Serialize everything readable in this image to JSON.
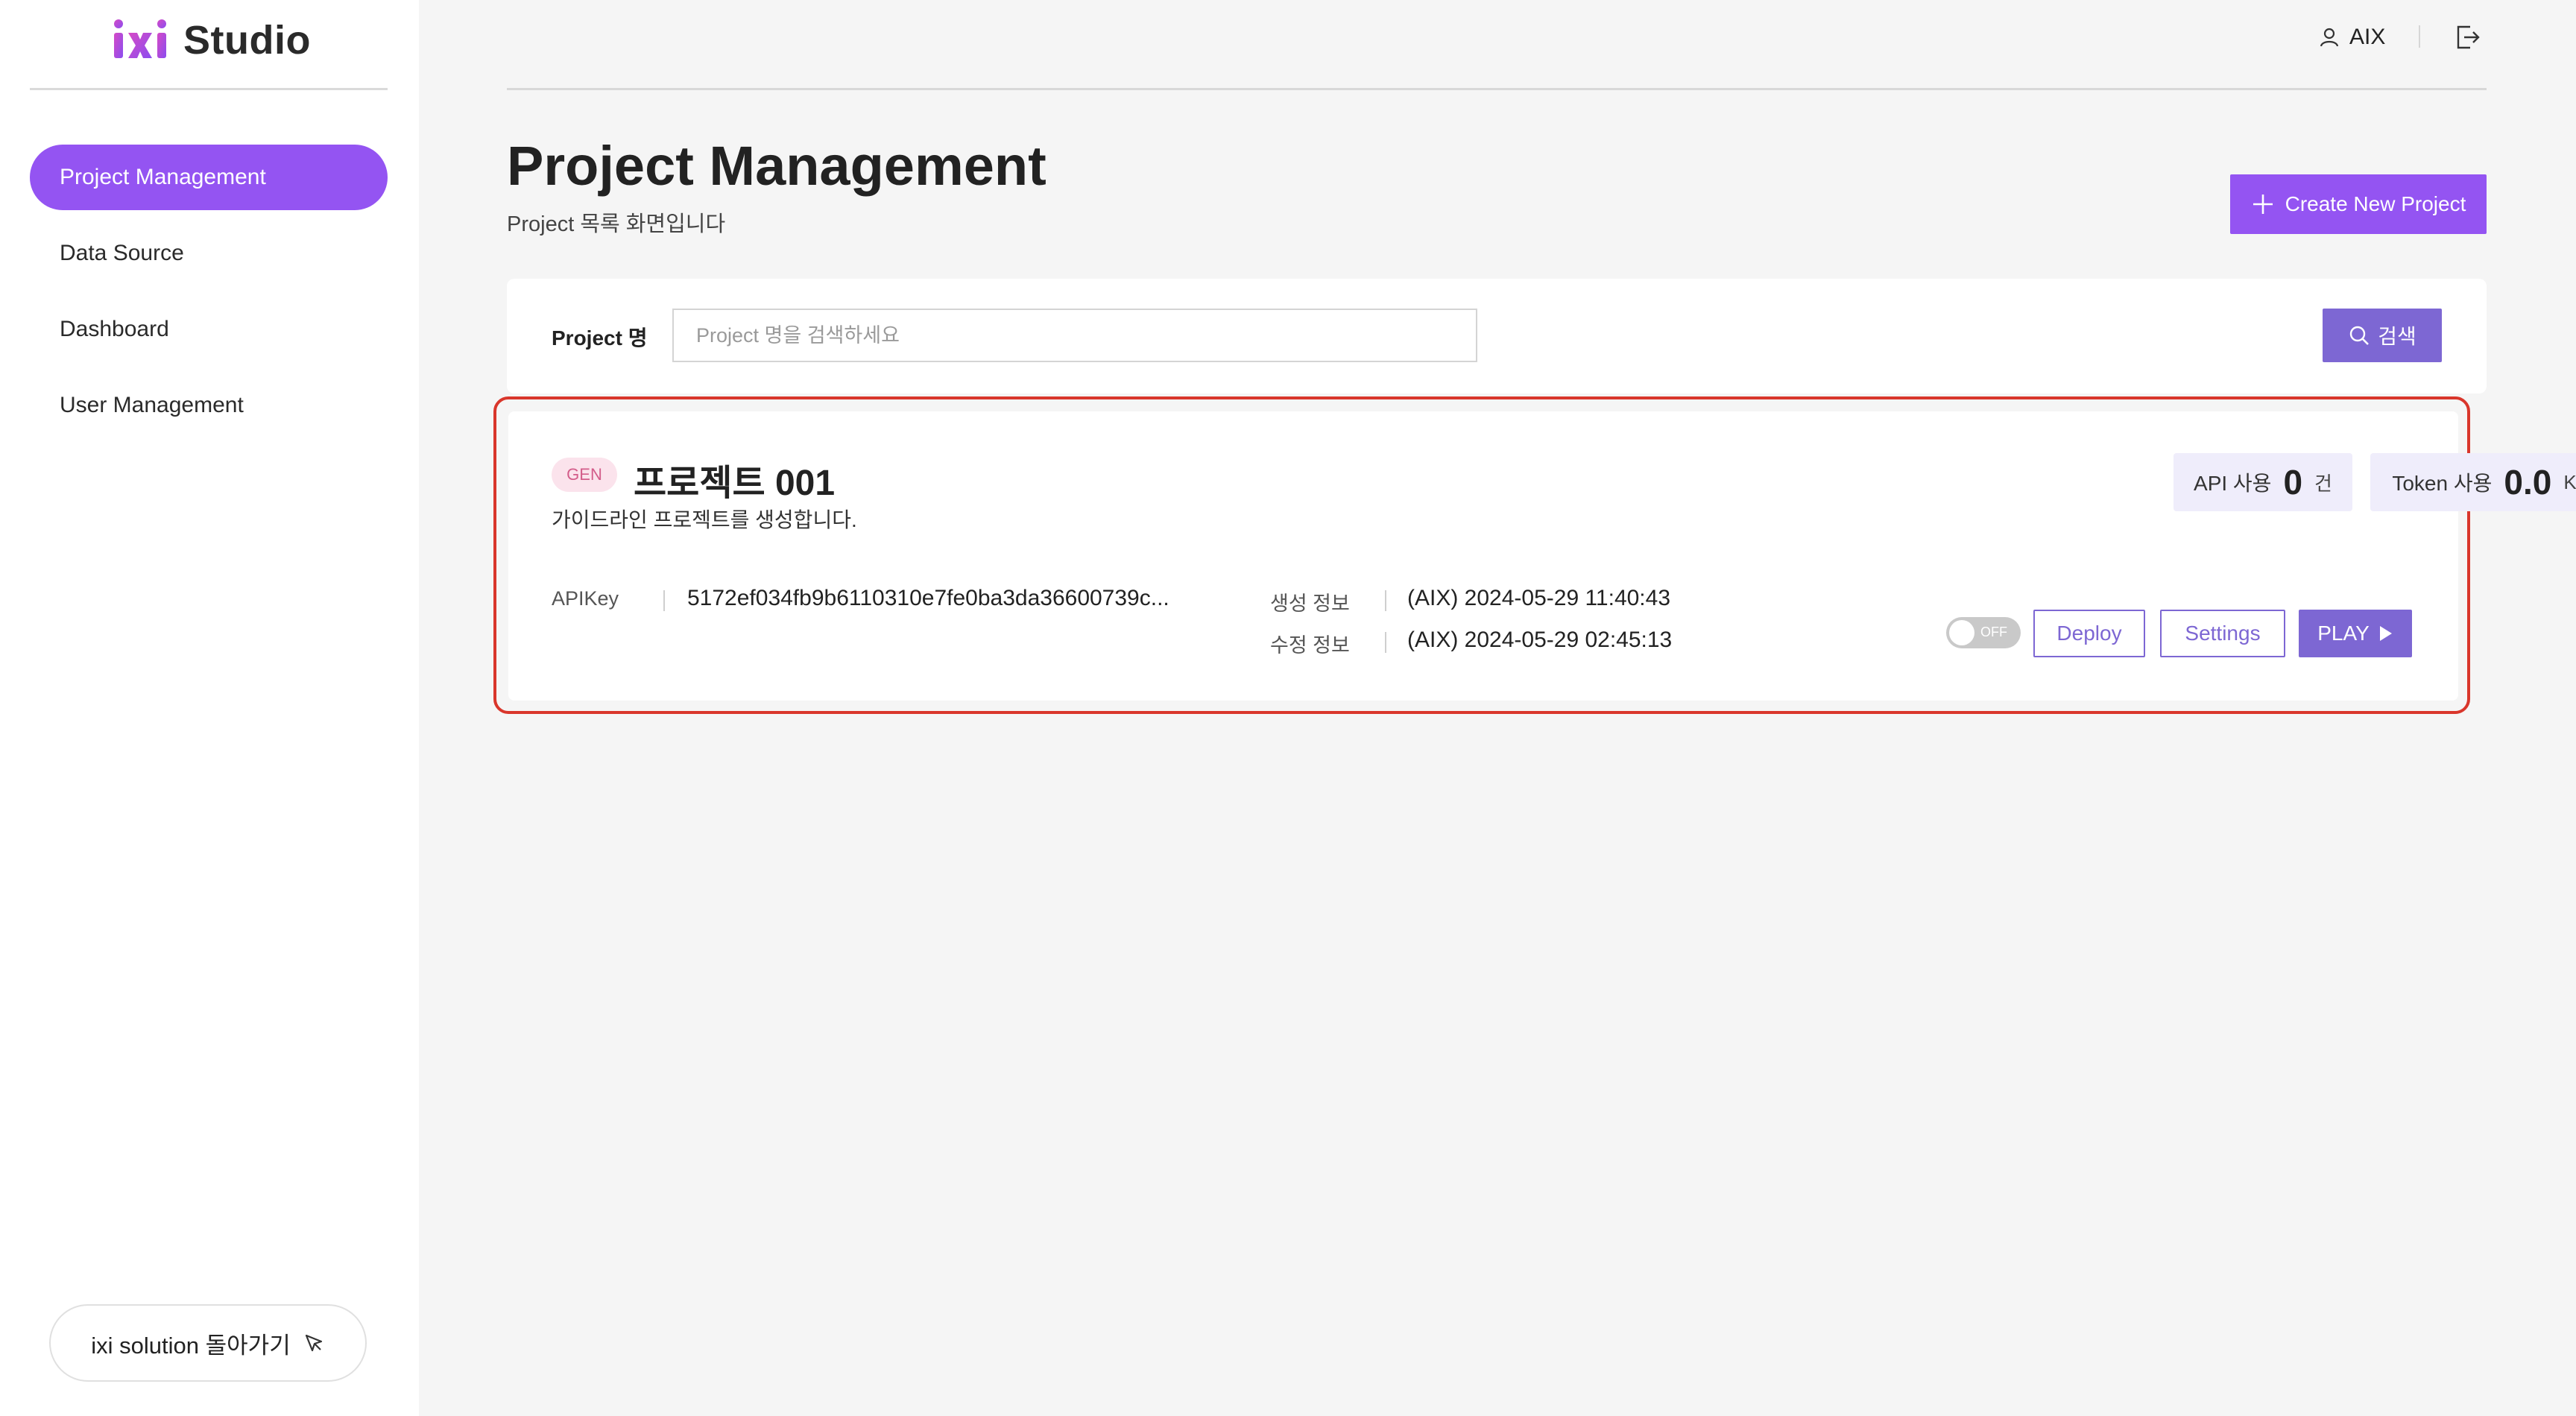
{
  "brand": {
    "name": "Studio",
    "logo_text": "ixi",
    "accent_color": "#9454f2"
  },
  "sidebar": {
    "items": [
      {
        "label": "Project Management",
        "active": true
      },
      {
        "label": "Data Source",
        "active": false
      },
      {
        "label": "Dashboard",
        "active": false
      },
      {
        "label": "User Management",
        "active": false
      }
    ],
    "back_label": "ixi solution 돌아가기"
  },
  "topbar": {
    "user_name": "AIX"
  },
  "header": {
    "title": "Project Management",
    "subtitle": "Project 목록 화면입니다",
    "create_label": "Create New Project"
  },
  "search": {
    "label": "Project 명",
    "placeholder": "Project 명을 검색하세요",
    "value": "",
    "button_label": "검색"
  },
  "project": {
    "badge": "GEN",
    "name": "프로젝트 001",
    "description": "가이드라인 프로젝트를 생성합니다.",
    "api_usage": {
      "label": "API 사용",
      "value": "0",
      "unit": "건"
    },
    "token_usage": {
      "label": "Token 사용",
      "value": "0.0",
      "unit": "K"
    },
    "apikey_label": "APIKey",
    "apikey_value": "5172ef034fb9b6110310e7fe0ba3da36600739c...",
    "created_label": "생성 정보",
    "created_value": "(AIX) 2024-05-29 11:40:43",
    "modified_label": "수정 정보",
    "modified_value": "(AIX) 2024-05-29 02:45:13",
    "toggle_label": "OFF",
    "toggle_on": false,
    "deploy_label": "Deploy",
    "settings_label": "Settings",
    "play_label": "PLAY"
  }
}
